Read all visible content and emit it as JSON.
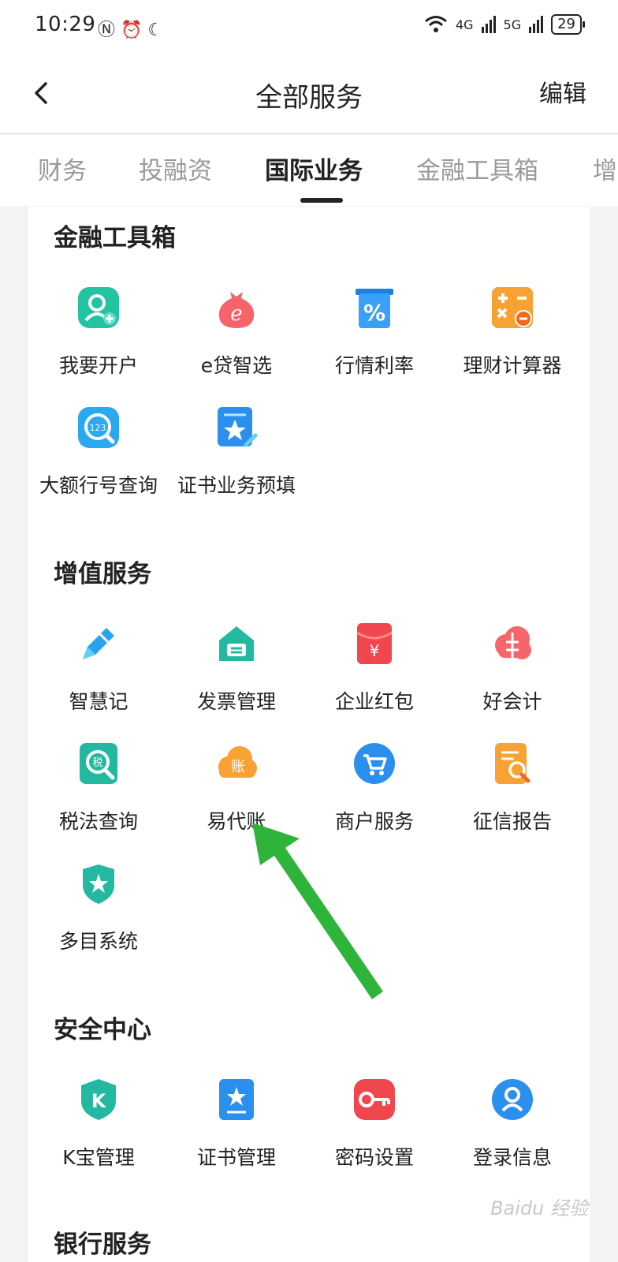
{
  "status_bar": {
    "time": "10:29",
    "left_icons": "Ⓝ ⏰ ☾",
    "net1": "4G",
    "net2": "5G",
    "battery": "29"
  },
  "header": {
    "title": "全部服务",
    "edit": "编辑"
  },
  "tabs": [
    "财务",
    "投融资",
    "国际业务",
    "金融工具箱",
    "增"
  ],
  "active_tab": "国际业务",
  "sections": {
    "toolbox": {
      "title": "金融工具箱",
      "items": [
        "我要开户",
        "e贷智选",
        "行情利率",
        "理财计算器",
        "大额行号查询",
        "证书业务预填"
      ]
    },
    "value_added": {
      "title": "增值服务",
      "items": [
        "智慧记",
        "发票管理",
        "企业红包",
        "好会计",
        "税法查询",
        "易代账",
        "商户服务",
        "征信报告",
        "多目系统"
      ]
    },
    "security": {
      "title": "安全中心",
      "items": [
        "K宝管理",
        "证书管理",
        "密码设置",
        "登录信息"
      ]
    },
    "bank": {
      "title": "银行服务"
    }
  },
  "icon_text": {
    "ticket": "%",
    "yen": "¥",
    "tax": "税",
    "zhang": "账",
    "k": "K",
    "q123": "123"
  },
  "watermark": "Baidu 经验",
  "annotation_arrow_color": "#2fb43a"
}
